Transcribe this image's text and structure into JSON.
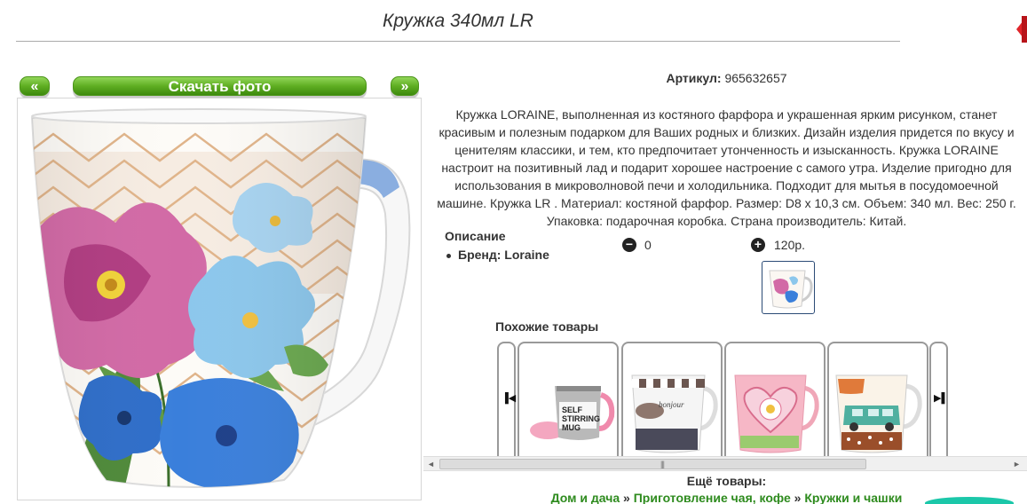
{
  "title": "Кружка 340мл LR",
  "buttons": {
    "prev": "«",
    "download": "Скачать фото",
    "next": "»"
  },
  "article": {
    "label": "Артикул:",
    "value": "965632657"
  },
  "description": "Кружка LORAINE, выполненная из костяного фарфора и украшенная ярким рисунком, станет красивым и полезным подарком для Ваших родных и близких. Дизайн изделия придется по вкусу и ценителям классики, и тем, кто предпочитает утонченность и изысканность. Кружка LORAINE настроит на позитивный лад и подарит хорошее настроение с самого утра. Изделие пригодно для использования в микроволновой печи и холодильника. Подходит для мытья в посудомоечной машине. Кружка LR . Материал: костяной фарфор. Размер: D8 х 10,3 см. Объем: 340 мл. Вес: 250 г. Упаковка: подарочная коробка. Страна производитель: Китай.",
  "specs": {
    "heading": "Описание",
    "brand": "Бренд: Loraine"
  },
  "price": {
    "minus_value": "0",
    "plus_value": "120р."
  },
  "similar": {
    "title": "Похожие товары",
    "items": [
      {
        "text": "SELF STIRRING MUG"
      },
      {
        "text": "bonjour"
      },
      {
        "text": ""
      },
      {
        "text": ""
      }
    ]
  },
  "more": {
    "title": "Ещё товары:"
  },
  "breadcrumbs": [
    "Дом и дача",
    "Приготовление чая, кофе",
    "Кружки и чашки"
  ],
  "breadcrumb_sep": "»",
  "scrollbar": {
    "left": "◄",
    "right": "►",
    "grip": "|||"
  },
  "colors": {
    "green_button": "#5fae22",
    "link_green": "#2e8b1e",
    "thumb_border": "#2b4b76"
  }
}
